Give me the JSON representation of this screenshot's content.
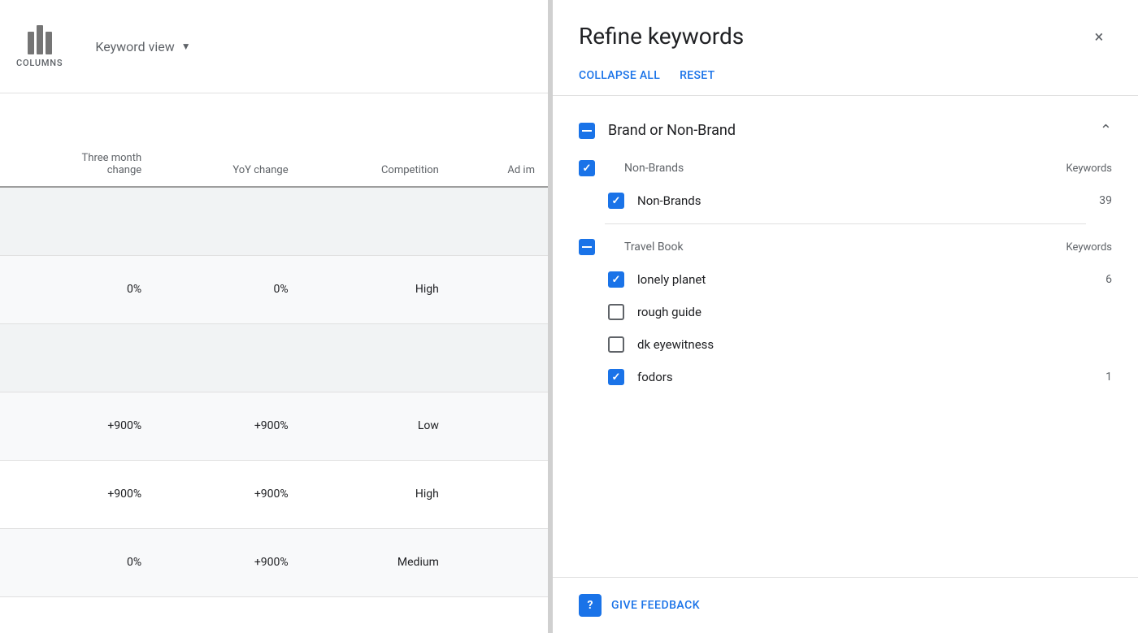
{
  "toolbar": {
    "columns_label": "COLUMNS",
    "keyword_view_label": "Keyword view"
  },
  "table": {
    "headers": [
      {
        "id": "three_month",
        "label": "Three month\nchange",
        "lines": [
          "Three month",
          "change"
        ]
      },
      {
        "id": "yoy_change",
        "label": "YoY change",
        "lines": [
          "YoY change"
        ]
      },
      {
        "id": "competition",
        "label": "Competition",
        "lines": [
          "Competition"
        ]
      },
      {
        "id": "ad_imp",
        "label": "Ad im",
        "lines": [
          "Ad im"
        ]
      }
    ],
    "rows": [
      {
        "type": "group",
        "cells": [
          "",
          "",
          "",
          ""
        ]
      },
      {
        "type": "data",
        "cells": [
          "0%",
          "0%",
          "High",
          ""
        ]
      },
      {
        "type": "group",
        "cells": [
          "",
          "",
          "",
          ""
        ]
      },
      {
        "type": "data",
        "cells": [
          "+900%",
          "+900%",
          "Low",
          ""
        ]
      },
      {
        "type": "data",
        "cells": [
          "+900%",
          "+900%",
          "High",
          ""
        ]
      },
      {
        "type": "data",
        "cells": [
          "0%",
          "+900%",
          "Medium",
          ""
        ]
      }
    ]
  },
  "refine": {
    "title": "Refine keywords",
    "collapse_all": "COLLAPSE ALL",
    "reset": "RESET",
    "close_label": "×",
    "sections": [
      {
        "id": "brand_non_brand",
        "title": "Brand or Non-Brand",
        "expanded": true,
        "state": "minus",
        "groups": [
          {
            "name": "Non-Brands",
            "count_label": "Keywords",
            "state": "checked",
            "items": [
              {
                "name": "Non-Brands",
                "count": "39",
                "checked": true
              }
            ]
          },
          {
            "name": "Travel Book",
            "count_label": "Keywords",
            "state": "minus",
            "items": [
              {
                "name": "lonely planet",
                "count": "6",
                "checked": true
              },
              {
                "name": "rough guide",
                "count": "",
                "checked": false
              },
              {
                "name": "dk eyewitness",
                "count": "",
                "checked": false
              },
              {
                "name": "fodors",
                "count": "1",
                "checked": true
              }
            ]
          }
        ]
      }
    ],
    "feedback": {
      "label": "GIVE FEEDBACK"
    }
  }
}
